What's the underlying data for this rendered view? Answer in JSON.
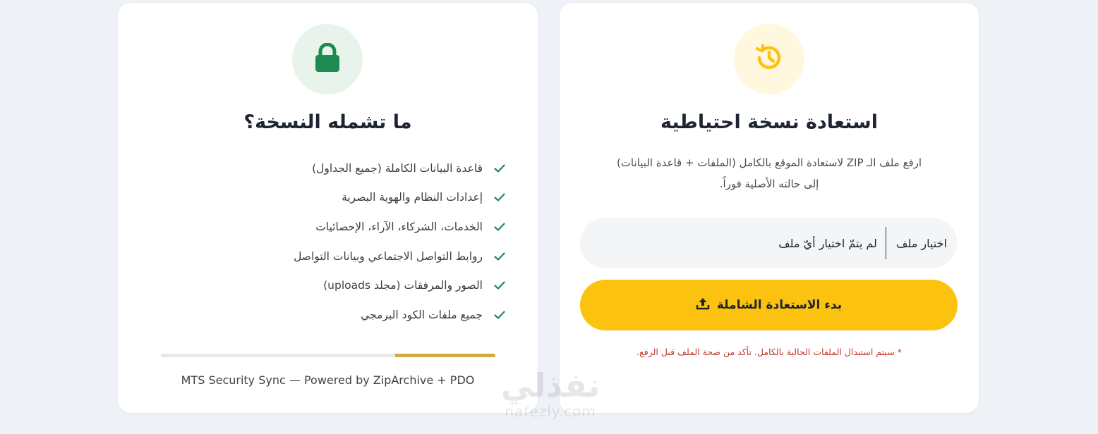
{
  "info_card": {
    "title": "ما تشمله النسخة؟",
    "icon": "lock-icon",
    "icon_color": "#1e8a52",
    "features": [
      "قاعدة البيانات الكاملة (جميع الجداول)",
      "إعدادات النظام والهوية البصرية",
      "الخدمات، الشركاء، الآراء، الإحصائيات",
      "روابط التواصل الاجتماعي وبيانات التواصل",
      "الصور والمرفقات (مجلد uploads)",
      "جميع ملفات الكود البرمجي"
    ],
    "check_color": "#1e8a52",
    "progress": 0.3,
    "footer": "MTS Security Sync — Powered by ZipArchive + PDO"
  },
  "restore_card": {
    "title": "استعادة نسخة احتياطية",
    "icon": "history-icon",
    "icon_color": "#fbc310",
    "description_line1": "ارفع ملف الـ ZIP لاستعادة الموقع بالكامل (الملفات + قاعدة البيانات)",
    "description_line2": "إلى حالته الأصلية فوراً.",
    "file_button_label": "اختيار ملف",
    "file_status": "لم يتمّ اختيار أيّ ملف",
    "start_button_label": "بدء الاستعادة الشاملة",
    "start_button_icon": "upload-icon",
    "warning": "* سيتم استبدال الملفات الحالية بالكامل. تأكد من صحة الملف قبل الرفع."
  },
  "watermark": {
    "arabic": "نفذلي",
    "latin": "nafezly.com"
  },
  "colors": {
    "accent": "#fbc310",
    "success": "#1e8a52",
    "danger": "#c0392b",
    "background": "#eef1f6"
  }
}
